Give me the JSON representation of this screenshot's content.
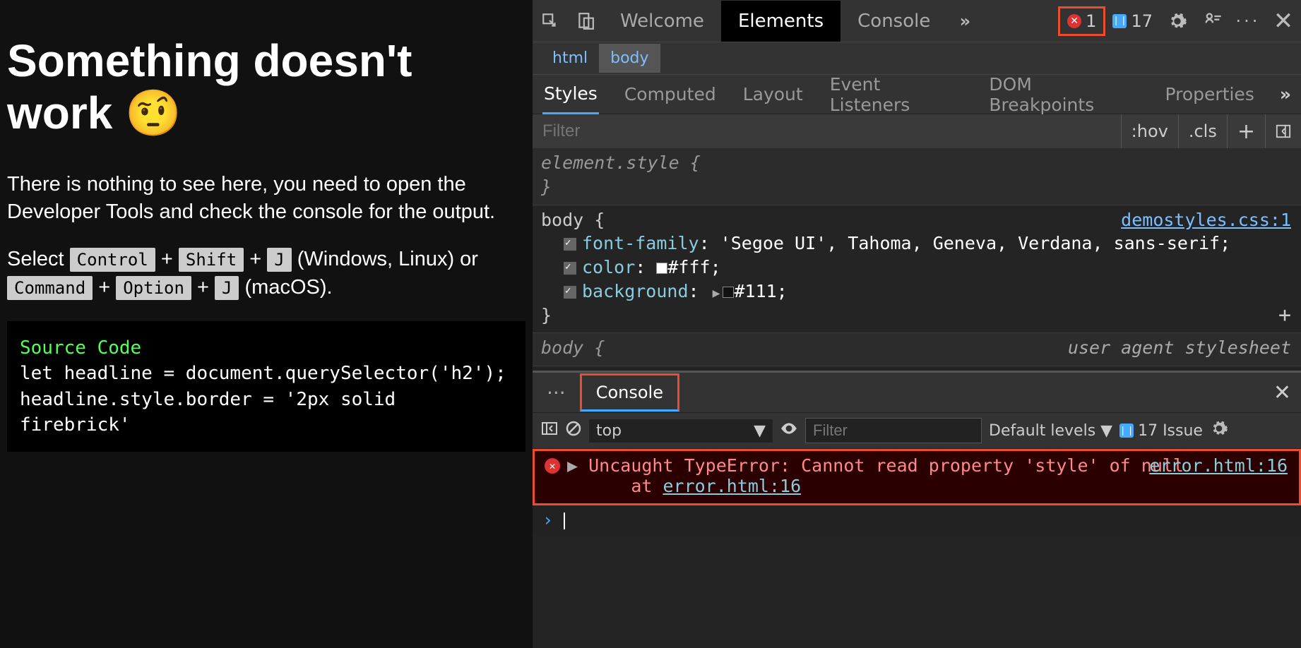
{
  "page": {
    "heading": "Something doesn't work 🤨",
    "intro": "There is nothing to see here, you need to open the Developer Tools and check the console for the output.",
    "shortcut_prefix": "Select ",
    "kbd_win": [
      "Control",
      "Shift",
      "J"
    ],
    "shortcut_win_suffix": " (Windows, Linux) or ",
    "kbd_mac": [
      "Command",
      "Option",
      "J"
    ],
    "shortcut_mac_suffix": " (macOS).",
    "code_title": "Source Code",
    "code_line1": "let headline = document.querySelector('h2');",
    "code_line2": "headline.style.border = '2px solid firebrick'"
  },
  "tabs": {
    "welcome": "Welcome",
    "elements": "Elements",
    "console": "Console"
  },
  "badges": {
    "errors": "1",
    "issues": "17"
  },
  "breadcrumbs": {
    "a": "html",
    "b": "body"
  },
  "subtabs": {
    "styles": "Styles",
    "computed": "Computed",
    "layout": "Layout",
    "listeners": "Event Listeners",
    "dombp": "DOM Breakpoints",
    "props": "Properties"
  },
  "filter": {
    "placeholder": "Filter",
    "hov": ":hov",
    "cls": ".cls"
  },
  "rule0": {
    "sel": "element.style {",
    "close": "}"
  },
  "rule1": {
    "sel": "body {",
    "src": "demostyles.css:1",
    "p1": "font-family",
    "v1": ": 'Segoe UI', Tahoma, Geneva, Verdana, sans-serif;",
    "p2": "color",
    "v2a": ": ",
    "v2b": "#fff;",
    "p3": "background",
    "v3a": ": ",
    "v3b": "#111;",
    "close": "}"
  },
  "rule2": {
    "sel": "body {",
    "src": "user agent stylesheet"
  },
  "drawer": {
    "console_tab": "Console"
  },
  "ctoolbar": {
    "context": "top",
    "filter_placeholder": "Filter",
    "levels": "Default levels ▼",
    "issues_text": "17 Issue"
  },
  "error": {
    "msg": "Uncaught TypeError: Cannot read property 'style' of null",
    "at": "at ",
    "atlink": "error.html:16",
    "srclink": "error.html:16"
  },
  "prompt": "› "
}
